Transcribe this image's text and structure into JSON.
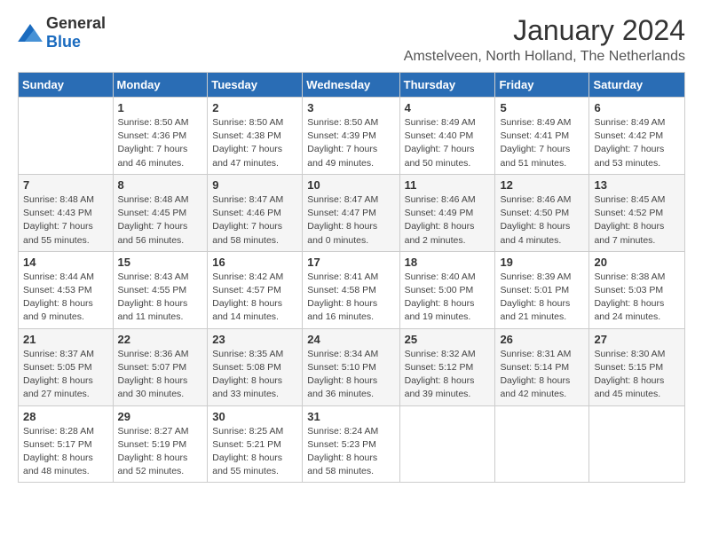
{
  "logo": {
    "general": "General",
    "blue": "Blue"
  },
  "header": {
    "title": "January 2024",
    "location": "Amstelveen, North Holland, The Netherlands"
  },
  "weekdays": [
    "Sunday",
    "Monday",
    "Tuesday",
    "Wednesday",
    "Thursday",
    "Friday",
    "Saturday"
  ],
  "weeks": [
    [
      {
        "day": "",
        "info": ""
      },
      {
        "day": "1",
        "info": "Sunrise: 8:50 AM\nSunset: 4:36 PM\nDaylight: 7 hours\nand 46 minutes."
      },
      {
        "day": "2",
        "info": "Sunrise: 8:50 AM\nSunset: 4:38 PM\nDaylight: 7 hours\nand 47 minutes."
      },
      {
        "day": "3",
        "info": "Sunrise: 8:50 AM\nSunset: 4:39 PM\nDaylight: 7 hours\nand 49 minutes."
      },
      {
        "day": "4",
        "info": "Sunrise: 8:49 AM\nSunset: 4:40 PM\nDaylight: 7 hours\nand 50 minutes."
      },
      {
        "day": "5",
        "info": "Sunrise: 8:49 AM\nSunset: 4:41 PM\nDaylight: 7 hours\nand 51 minutes."
      },
      {
        "day": "6",
        "info": "Sunrise: 8:49 AM\nSunset: 4:42 PM\nDaylight: 7 hours\nand 53 minutes."
      }
    ],
    [
      {
        "day": "7",
        "info": "Sunrise: 8:48 AM\nSunset: 4:43 PM\nDaylight: 7 hours\nand 55 minutes."
      },
      {
        "day": "8",
        "info": "Sunrise: 8:48 AM\nSunset: 4:45 PM\nDaylight: 7 hours\nand 56 minutes."
      },
      {
        "day": "9",
        "info": "Sunrise: 8:47 AM\nSunset: 4:46 PM\nDaylight: 7 hours\nand 58 minutes."
      },
      {
        "day": "10",
        "info": "Sunrise: 8:47 AM\nSunset: 4:47 PM\nDaylight: 8 hours\nand 0 minutes."
      },
      {
        "day": "11",
        "info": "Sunrise: 8:46 AM\nSunset: 4:49 PM\nDaylight: 8 hours\nand 2 minutes."
      },
      {
        "day": "12",
        "info": "Sunrise: 8:46 AM\nSunset: 4:50 PM\nDaylight: 8 hours\nand 4 minutes."
      },
      {
        "day": "13",
        "info": "Sunrise: 8:45 AM\nSunset: 4:52 PM\nDaylight: 8 hours\nand 7 minutes."
      }
    ],
    [
      {
        "day": "14",
        "info": "Sunrise: 8:44 AM\nSunset: 4:53 PM\nDaylight: 8 hours\nand 9 minutes."
      },
      {
        "day": "15",
        "info": "Sunrise: 8:43 AM\nSunset: 4:55 PM\nDaylight: 8 hours\nand 11 minutes."
      },
      {
        "day": "16",
        "info": "Sunrise: 8:42 AM\nSunset: 4:57 PM\nDaylight: 8 hours\nand 14 minutes."
      },
      {
        "day": "17",
        "info": "Sunrise: 8:41 AM\nSunset: 4:58 PM\nDaylight: 8 hours\nand 16 minutes."
      },
      {
        "day": "18",
        "info": "Sunrise: 8:40 AM\nSunset: 5:00 PM\nDaylight: 8 hours\nand 19 minutes."
      },
      {
        "day": "19",
        "info": "Sunrise: 8:39 AM\nSunset: 5:01 PM\nDaylight: 8 hours\nand 21 minutes."
      },
      {
        "day": "20",
        "info": "Sunrise: 8:38 AM\nSunset: 5:03 PM\nDaylight: 8 hours\nand 24 minutes."
      }
    ],
    [
      {
        "day": "21",
        "info": "Sunrise: 8:37 AM\nSunset: 5:05 PM\nDaylight: 8 hours\nand 27 minutes."
      },
      {
        "day": "22",
        "info": "Sunrise: 8:36 AM\nSunset: 5:07 PM\nDaylight: 8 hours\nand 30 minutes."
      },
      {
        "day": "23",
        "info": "Sunrise: 8:35 AM\nSunset: 5:08 PM\nDaylight: 8 hours\nand 33 minutes."
      },
      {
        "day": "24",
        "info": "Sunrise: 8:34 AM\nSunset: 5:10 PM\nDaylight: 8 hours\nand 36 minutes."
      },
      {
        "day": "25",
        "info": "Sunrise: 8:32 AM\nSunset: 5:12 PM\nDaylight: 8 hours\nand 39 minutes."
      },
      {
        "day": "26",
        "info": "Sunrise: 8:31 AM\nSunset: 5:14 PM\nDaylight: 8 hours\nand 42 minutes."
      },
      {
        "day": "27",
        "info": "Sunrise: 8:30 AM\nSunset: 5:15 PM\nDaylight: 8 hours\nand 45 minutes."
      }
    ],
    [
      {
        "day": "28",
        "info": "Sunrise: 8:28 AM\nSunset: 5:17 PM\nDaylight: 8 hours\nand 48 minutes."
      },
      {
        "day": "29",
        "info": "Sunrise: 8:27 AM\nSunset: 5:19 PM\nDaylight: 8 hours\nand 52 minutes."
      },
      {
        "day": "30",
        "info": "Sunrise: 8:25 AM\nSunset: 5:21 PM\nDaylight: 8 hours\nand 55 minutes."
      },
      {
        "day": "31",
        "info": "Sunrise: 8:24 AM\nSunset: 5:23 PM\nDaylight: 8 hours\nand 58 minutes."
      },
      {
        "day": "",
        "info": ""
      },
      {
        "day": "",
        "info": ""
      },
      {
        "day": "",
        "info": ""
      }
    ]
  ]
}
